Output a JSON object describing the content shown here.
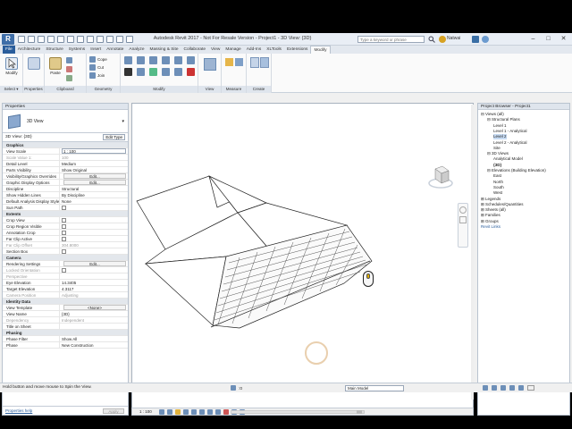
{
  "app": {
    "title": "Autodesk Revit 2017 - Not For Resale Version -   Project1 - 3D View: {3D}",
    "search_placeholder": "Type a keyword or phrase",
    "user": "Natwai",
    "logo_text": "R"
  },
  "tabs": [
    "File",
    "Architecture",
    "Structure",
    "Systems",
    "Insert",
    "Annotate",
    "Analyze",
    "Massing & Site",
    "Collaborate",
    "View",
    "Manage",
    "Add-Ins",
    "XLTools",
    "Extensions",
    "Modify"
  ],
  "active_tab": "Modify",
  "ribbon": {
    "panels": [
      "Select ▾",
      "Properties",
      "Clipboard",
      "Geometry",
      "Modify",
      "View",
      "Measure",
      "Create"
    ],
    "modify_label": "Modify",
    "paste_label": "Paste",
    "cope": "Cope",
    "cut": "Cut",
    "join": "Join"
  },
  "properties": {
    "header": "Properties",
    "type_name": "3D View",
    "filter_value": "3D View: {3D}",
    "edit_type": "Edit Type",
    "help_link": "Properties help",
    "apply": "Apply",
    "rows": [
      {
        "k": "Graphics",
        "sec": true
      },
      {
        "k": "View Scale",
        "v": "1 : 100",
        "box": true
      },
      {
        "k": "Scale Value    1:",
        "v": "100",
        "grey": true
      },
      {
        "k": "Detail Level",
        "v": "Medium"
      },
      {
        "k": "Parts Visibility",
        "v": "Show Original"
      },
      {
        "k": "Visibility/Graphics Overrides",
        "v": "Edit...",
        "btn": true
      },
      {
        "k": "Graphic Display Options",
        "v": "Edit...",
        "btn": true
      },
      {
        "k": "Discipline",
        "v": "Structural"
      },
      {
        "k": "Show Hidden Lines",
        "v": "By Discipline"
      },
      {
        "k": "Default Analysis Display Style",
        "v": "None"
      },
      {
        "k": "Sun Path",
        "chk": true
      },
      {
        "k": "Extents",
        "sec": true
      },
      {
        "k": "Crop View",
        "chk": true
      },
      {
        "k": "Crop Region Visible",
        "chk": true
      },
      {
        "k": "Annotation Crop",
        "chk": true
      },
      {
        "k": "Far Clip Active",
        "chk": true
      },
      {
        "k": "Far Clip Offset",
        "v": "304.8000",
        "grey": true
      },
      {
        "k": "Section Box",
        "chk": true
      },
      {
        "k": "Camera",
        "sec": true
      },
      {
        "k": "Rendering Settings",
        "v": "Edit...",
        "btn": true
      },
      {
        "k": "Locked Orientation",
        "chk": true,
        "grey": true
      },
      {
        "k": "Perspective",
        "grey": true
      },
      {
        "k": "Eye Elevation",
        "v": "14.3405"
      },
      {
        "k": "Target Elevation",
        "v": "4.3117"
      },
      {
        "k": "Camera Position",
        "v": "Adjusting",
        "grey": true
      },
      {
        "k": "Identity Data",
        "sec": true
      },
      {
        "k": "View Template",
        "v": "<None>",
        "btn": true
      },
      {
        "k": "View Name",
        "v": "{3D}"
      },
      {
        "k": "Dependency",
        "v": "Independent",
        "grey": true
      },
      {
        "k": "Title on Sheet"
      },
      {
        "k": "Phasing",
        "sec": true
      },
      {
        "k": "Phase Filter",
        "v": "Show All"
      },
      {
        "k": "Phase",
        "v": "New Construction"
      }
    ]
  },
  "browser": {
    "header": "Project Browser - Project1",
    "items": [
      {
        "t": "⊟ Views (all)",
        "l": 0
      },
      {
        "t": "⊟ Structural Plans",
        "l": 1
      },
      {
        "t": "Level 1",
        "l": 2
      },
      {
        "t": "Level 1 - Analytical",
        "l": 2
      },
      {
        "t": "Level 2",
        "l": 2,
        "sel": true
      },
      {
        "t": "Level 2 - Analytical",
        "l": 2
      },
      {
        "t": "Site",
        "l": 2
      },
      {
        "t": "⊟ 3D Views",
        "l": 1
      },
      {
        "t": "Analytical Model",
        "l": 2
      },
      {
        "t": "{3D}",
        "l": 2,
        "bold": true
      },
      {
        "t": "⊟ Elevations (Building Elevation)",
        "l": 1
      },
      {
        "t": "East",
        "l": 2
      },
      {
        "t": "North",
        "l": 2
      },
      {
        "t": "South",
        "l": 2
      },
      {
        "t": "West",
        "l": 2
      },
      {
        "t": "⊞ Legends",
        "l": 0
      },
      {
        "t": "⊞ Schedules/Quantities",
        "l": 0
      },
      {
        "t": "⊞ Sheets (all)",
        "l": 0
      },
      {
        "t": "⊞ Families",
        "l": 0
      },
      {
        "t": "⊞ Groups",
        "l": 0
      },
      {
        "t": "Revit Links",
        "l": 0,
        "link": true
      }
    ]
  },
  "viewbar": {
    "scale": "1 : 100"
  },
  "statusbar": {
    "text": "Hold button and move mouse to Spin the View.",
    "workset": "Main Model",
    "zero": ":0"
  },
  "colors": {
    "accent": "#2a5d9b",
    "ribbon_bg": "#fafafa",
    "panel_label": "#dfe5ed"
  }
}
